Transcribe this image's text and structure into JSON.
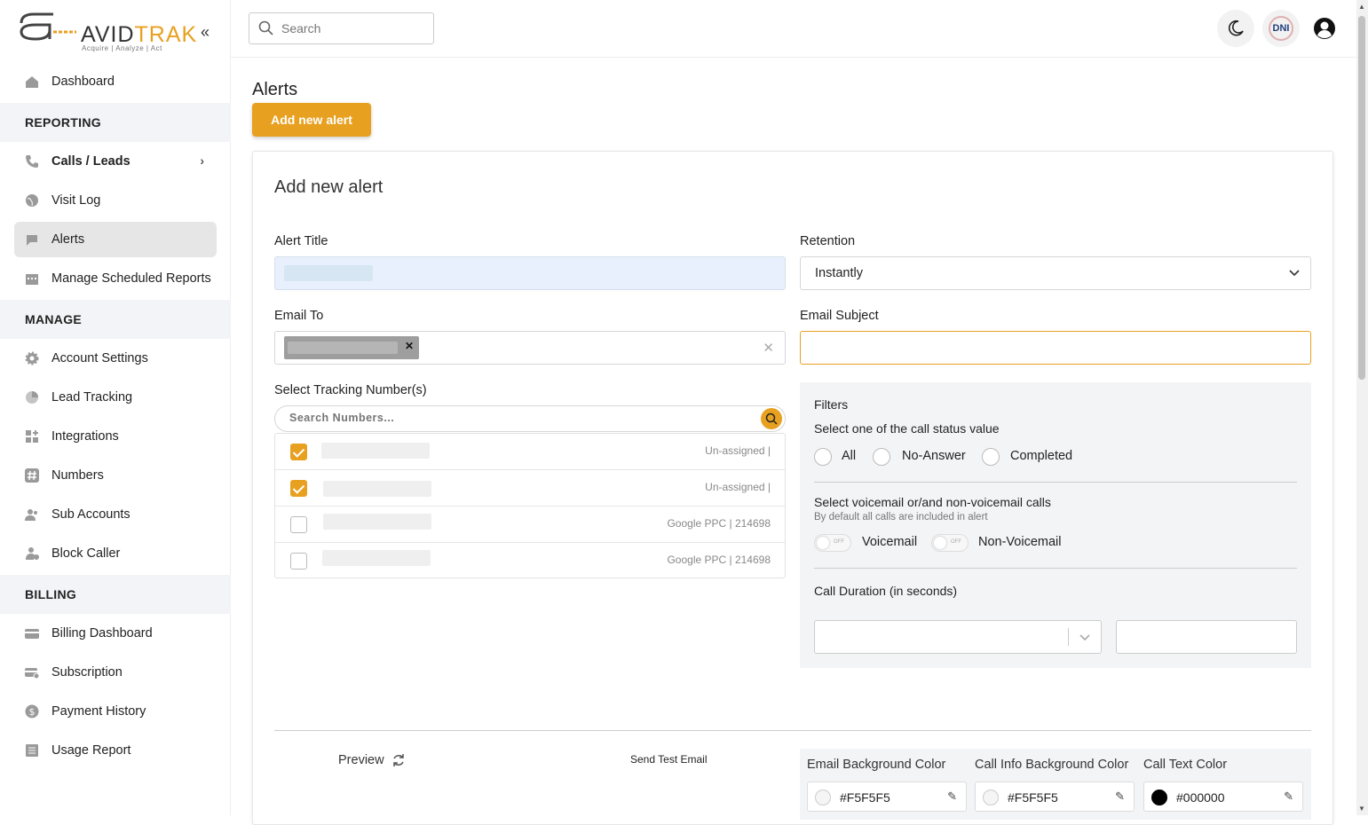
{
  "brand": {
    "name_a": "AVID",
    "name_b": "TRAK",
    "tagline": "Acquire  |  Analyze  |  Act"
  },
  "sidebar": {
    "collapse_icon": "double-chevron-left-icon",
    "items_top": [
      {
        "label": "Dashboard",
        "icon": "home-icon"
      }
    ],
    "sections": [
      {
        "title": "REPORTING",
        "items": [
          {
            "label": "Calls / Leads",
            "icon": "phone-icon",
            "has_submenu": true
          },
          {
            "label": "Visit Log",
            "icon": "globe-icon"
          },
          {
            "label": "Alerts",
            "icon": "chat-alert-icon",
            "active": true
          },
          {
            "label": "Manage Scheduled Reports",
            "icon": "calendar-icon"
          }
        ]
      },
      {
        "title": "MANAGE",
        "items": [
          {
            "label": "Account Settings",
            "icon": "gear-icon"
          },
          {
            "label": "Lead Tracking",
            "icon": "pie-icon"
          },
          {
            "label": "Integrations",
            "icon": "grid-plus-icon"
          },
          {
            "label": "Numbers",
            "icon": "hash-icon"
          },
          {
            "label": "Sub Accounts",
            "icon": "users-icon"
          },
          {
            "label": "Block Caller",
            "icon": "user-block-icon"
          }
        ]
      },
      {
        "title": "BILLING",
        "items": [
          {
            "label": "Billing Dashboard",
            "icon": "card-icon"
          },
          {
            "label": "Subscription",
            "icon": "card-refresh-icon"
          },
          {
            "label": "Payment History",
            "icon": "dollar-icon"
          },
          {
            "label": "Usage Report",
            "icon": "report-icon"
          }
        ]
      }
    ]
  },
  "topbar": {
    "search_placeholder": "Search",
    "dni_label": "DNI"
  },
  "page": {
    "title": "Alerts",
    "add_button": "Add new alert"
  },
  "form": {
    "title": "Add new alert",
    "alert_title_label": "Alert Title",
    "retention_label": "Retention",
    "retention_value": "Instantly",
    "email_to_label": "Email To",
    "email_subject_label": "Email Subject",
    "tracking_label": "Select Tracking Number(s)",
    "tracking_search_placeholder": "Search Numbers...",
    "tracking_rows": [
      {
        "checked": true,
        "source": "Un-assigned |"
      },
      {
        "checked": true,
        "source": "Un-assigned |"
      },
      {
        "checked": false,
        "source": "Google PPC | 214698"
      },
      {
        "checked": false,
        "source": "Google PPC | 214698"
      }
    ],
    "filters": {
      "title": "Filters",
      "status_label": "Select one of the call status value",
      "status_options": [
        "All",
        "No-Answer",
        "Completed"
      ],
      "voicemail_label": "Select voicemail or/and non-voicemail calls",
      "voicemail_hint": "By default all calls are included in alert",
      "toggle_off_text": "OFF",
      "voicemail_option": "Voicemail",
      "nonvoicemail_option": "Non-Voicemail",
      "duration_label": "Call Duration (in seconds)"
    },
    "preview_label": "Preview",
    "send_test_label": "Send Test Email",
    "colors": [
      {
        "label": "Email Background Color",
        "value": "#F5F5F5",
        "swatch": "#F5F5F5"
      },
      {
        "label": "Call Info Background Color",
        "value": "#F5F5F5",
        "swatch": "#F5F5F5"
      },
      {
        "label": "Call Text Color",
        "value": "#000000",
        "swatch": "#000000"
      }
    ]
  }
}
